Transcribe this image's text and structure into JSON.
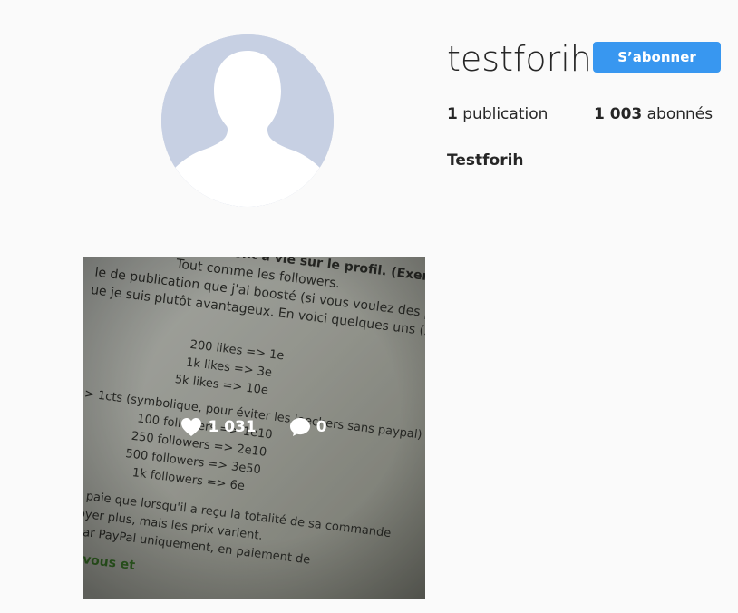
{
  "profile": {
    "username": "testforih",
    "follow_label": "S’abonner",
    "posts_count": "1",
    "posts_label": "publication",
    "followers_count": "1 003",
    "followers_label": "abonnés",
    "full_name": "Testforih"
  },
  "post": {
    "likes": "1 031",
    "comments": "0",
    "photo_text": [
      "nents, ils resteront à vie sur le profil. (Exemple d",
      "Tout comme les followers.",
      "le de publication que j'ai boosté (si vous voulez des preuv",
      "ue je suis plutôt avantageux. En voici quelques uns (susc",
      "200 likes => 1e",
      "1k likes => 3e",
      "5k likes => 10e",
      "=> 1cts (symbolique, pour éviter les leechers sans paypal)",
      "100 followers => 1e10",
      "250 followers => 2e10",
      "500 followers => 3e50",
      "1k followers => 6e",
      "e ne paie que lorsqu'il a reçu la totalité de sa commande",
      "envoyer plus, mais les prix varient.",
      "tue par PayPal uniquement, en paiement de",
      "quoi vous et"
    ]
  },
  "colors": {
    "accent": "#3897f0",
    "background": "#fafafa",
    "avatar_bg": "#c7d0e3"
  }
}
